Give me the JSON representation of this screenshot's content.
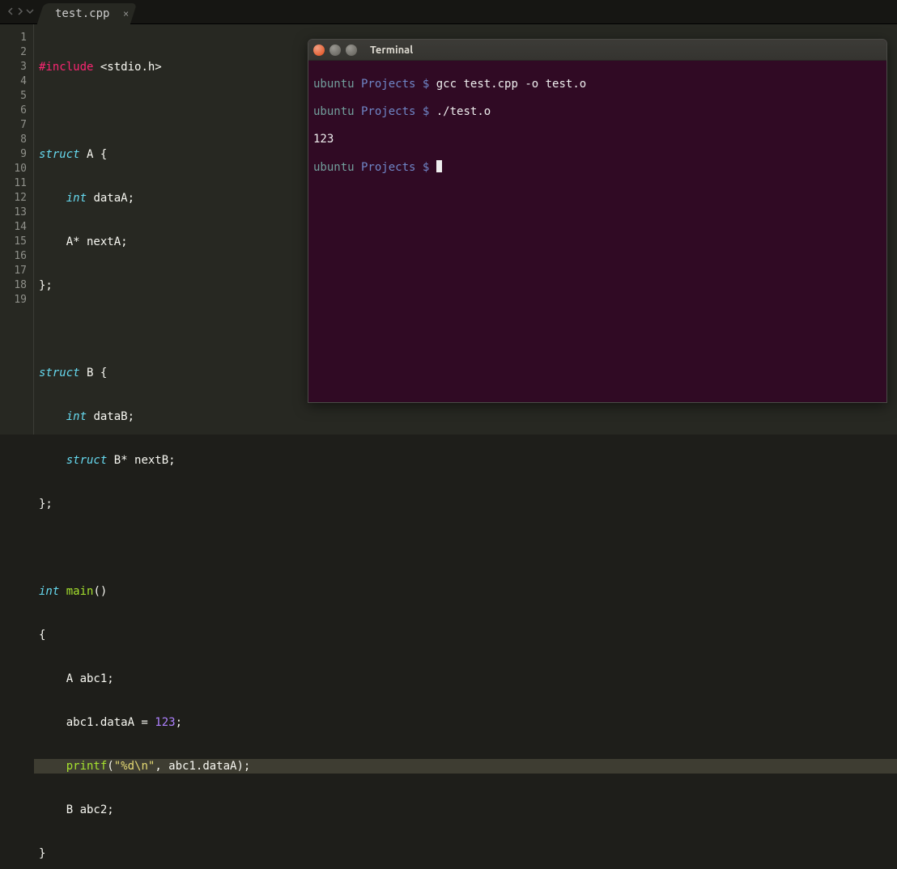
{
  "tabs": {
    "active": "test.cpp"
  },
  "gutter": [
    "1",
    "2",
    "3",
    "4",
    "5",
    "6",
    "7",
    "8",
    "9",
    "10",
    "11",
    "12",
    "13",
    "14",
    "15",
    "16",
    "17",
    "18",
    "19"
  ],
  "code": {
    "l1": {
      "preproc": "#include",
      "rest": " <stdio.h>"
    },
    "l2": "",
    "l3": {
      "kw": "struct",
      "name": " A {",
      "full_kw": "struct"
    },
    "l4": {
      "type": "int",
      "rest": " dataA;"
    },
    "l5": "    A* nextA;",
    "l6": "};",
    "l7": "",
    "l8": {
      "kw": "struct",
      "name": " B {"
    },
    "l9": {
      "type": "int",
      "rest": " dataB;"
    },
    "l10": {
      "kw": "struct",
      "rest": " B* nextB;"
    },
    "l11": "};",
    "l12": "",
    "l13": {
      "type": "int",
      "func": " main",
      "after": "()"
    },
    "l14": "{",
    "l15": "    A abc1;",
    "l16": {
      "pre": "    abc1.dataA = ",
      "num": "123",
      "post": ";"
    },
    "l17": {
      "func": "printf",
      "open": "(",
      "str": "\"%d\\n\"",
      "post": ", abc1.dataA);"
    },
    "l18": "    B abc2;",
    "l19": "}"
  },
  "terminal": {
    "title": "Terminal",
    "lines": [
      {
        "user": "ubuntu",
        "path": " Projects ",
        "prompt": "$",
        "cmd": " gcc test.cpp -o test.o"
      },
      {
        "user": "ubuntu",
        "path": " Projects ",
        "prompt": "$",
        "cmd": " ./test.o"
      },
      {
        "out": "123"
      },
      {
        "user": "ubuntu",
        "path": " Projects ",
        "prompt": "$",
        "cmd": " ",
        "cursor": true
      }
    ]
  }
}
